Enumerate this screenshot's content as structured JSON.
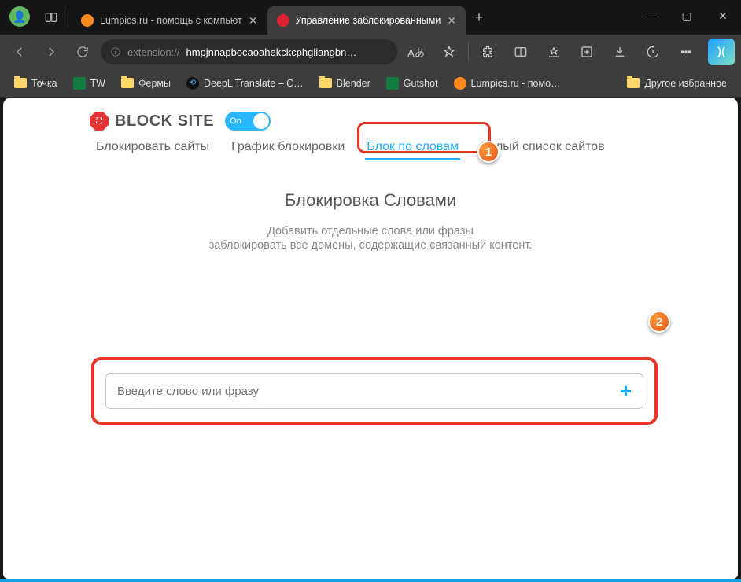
{
  "window": {
    "tabs": [
      {
        "title": "Lumpics.ru - помощь с компьют",
        "active": false
      },
      {
        "title": "Управление заблокированными",
        "active": true
      }
    ]
  },
  "urlbar": {
    "protocol": "extension://",
    "host": "hmpjnnapbocaoahekckcphgliangbn…",
    "reader_label": "Aあ"
  },
  "bookmarks": {
    "items": [
      {
        "label": "Точка",
        "icon": "folder"
      },
      {
        "label": "TW",
        "icon": "sheet"
      },
      {
        "label": "Фермы",
        "icon": "folder"
      },
      {
        "label": "DeepL Translate – C…",
        "icon": "circle"
      },
      {
        "label": "Blender",
        "icon": "folder"
      },
      {
        "label": "Gutshot",
        "icon": "sheet"
      },
      {
        "label": "Lumpics.ru - помо…",
        "icon": "orange"
      }
    ],
    "other": "Другое избранное"
  },
  "page": {
    "brand": "BLOCK SITE",
    "toggle_label": "On",
    "tabs": {
      "t1": "Блокировать сайты",
      "t2": "График блокировки",
      "t3": "Блок по словам",
      "t4": "Белый список сайтов"
    },
    "heading": "Блокировка Словами",
    "sub1": "Добавить отдельные слова или фразы",
    "sub2": "заблокировать все домены, содержащие связанный контент.",
    "input_placeholder": "Введите слово или фразу"
  },
  "annotations": {
    "b1": "1",
    "b2": "2"
  }
}
